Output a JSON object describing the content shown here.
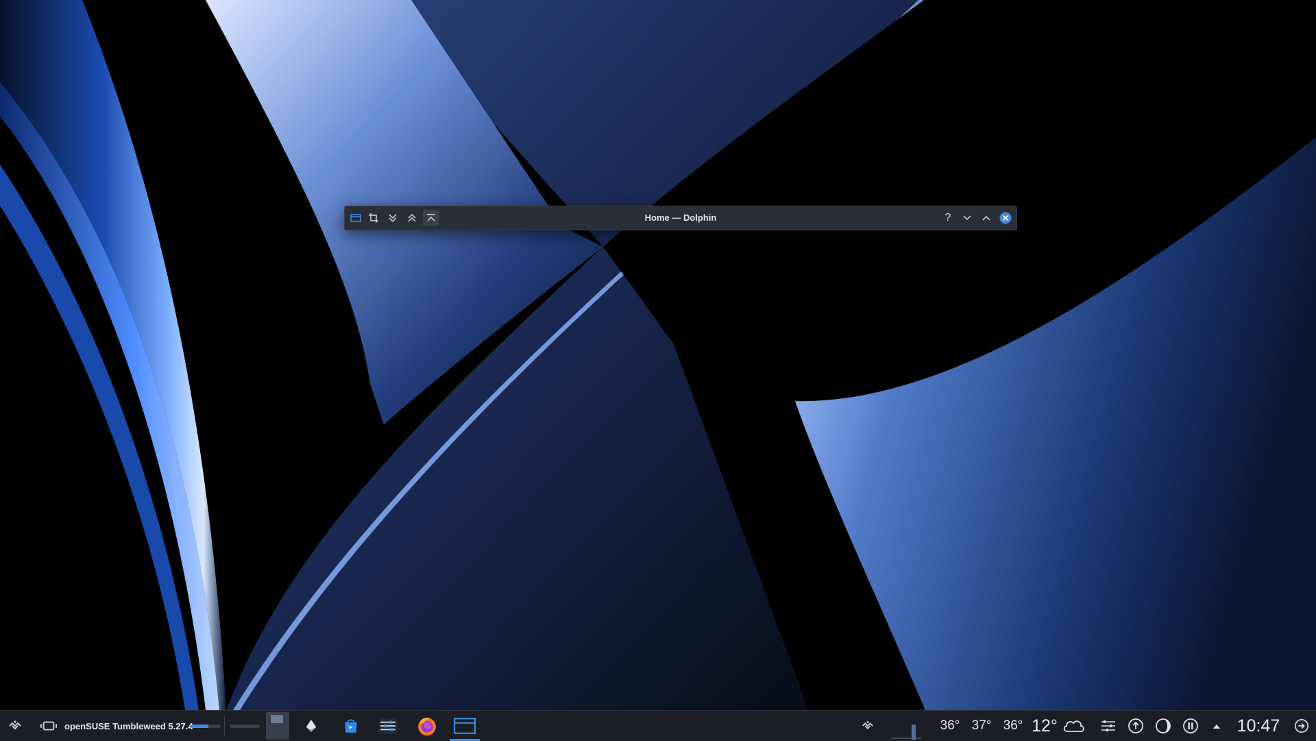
{
  "window": {
    "title": "Home — Dolphin",
    "left_buttons": [
      "app-menu-icon",
      "crop-icon",
      "keep-below-icon",
      "keep-above-icon",
      "shade-icon"
    ],
    "right_buttons": [
      "help-icon",
      "minimize-icon",
      "maximize-icon",
      "close-icon"
    ]
  },
  "panel": {
    "activity_label": "openSUSE Tumbleweed 5.27.4",
    "volume_level": 0.6,
    "taskbar": [
      {
        "name": "pager-desktop",
        "icon": "virtual-desktop-icon"
      },
      {
        "name": "inkscape",
        "icon": "inkscape-icon"
      },
      {
        "name": "discover",
        "icon": "discover-store-icon"
      },
      {
        "name": "system-settings",
        "icon": "settings-sliders-icon"
      },
      {
        "name": "firefox",
        "icon": "firefox-icon"
      },
      {
        "name": "dolphin",
        "icon": "folder-icon",
        "active": true
      }
    ],
    "tray": {
      "temps": [
        "36°",
        "37°",
        "36°"
      ],
      "weather_temp": "12°",
      "weather_icon": "cloud-icon",
      "clock": "10:47"
    }
  },
  "colors": {
    "panel_bg": "#1b1e24",
    "accent": "#3d8ee0",
    "close_button": "#4a8ad6"
  }
}
